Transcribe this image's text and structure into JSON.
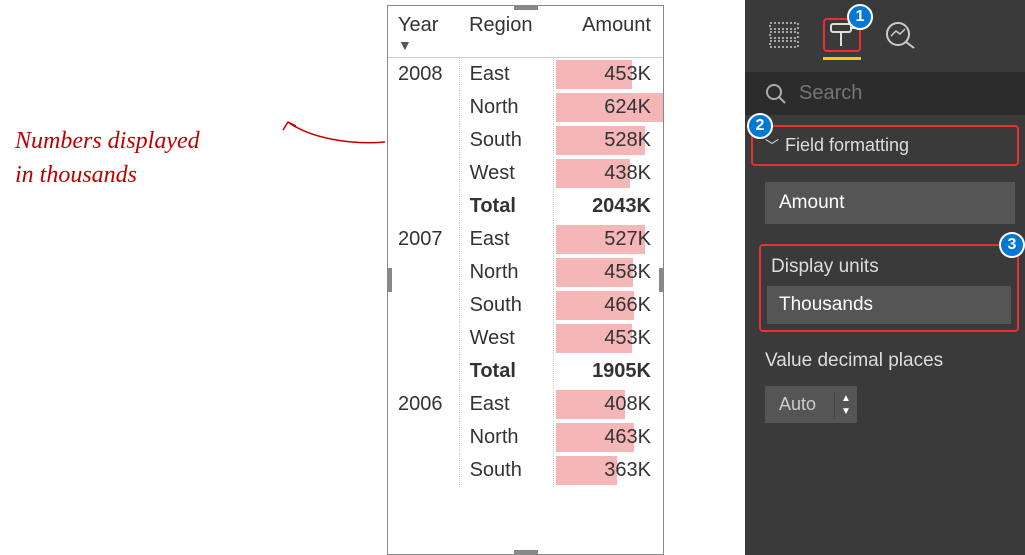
{
  "annotation": {
    "line1": "Numbers displayed",
    "line2": "in thousands"
  },
  "table": {
    "headers": {
      "year": "Year",
      "region": "Region",
      "amount": "Amount"
    },
    "rows": [
      {
        "year": "2008",
        "region": "East",
        "amount": "453K",
        "bar": 70
      },
      {
        "year": "",
        "region": "North",
        "amount": "624K",
        "bar": 98
      },
      {
        "year": "",
        "region": "South",
        "amount": "528K",
        "bar": 82
      },
      {
        "year": "",
        "region": "West",
        "amount": "438K",
        "bar": 68
      },
      {
        "year": "",
        "region": "Total",
        "amount": "2043K",
        "total": true
      },
      {
        "year": "2007",
        "region": "East",
        "amount": "527K",
        "bar": 82
      },
      {
        "year": "",
        "region": "North",
        "amount": "458K",
        "bar": 71
      },
      {
        "year": "",
        "region": "South",
        "amount": "466K",
        "bar": 72
      },
      {
        "year": "",
        "region": "West",
        "amount": "453K",
        "bar": 70
      },
      {
        "year": "",
        "region": "Total",
        "amount": "1905K",
        "total": true
      },
      {
        "year": "2006",
        "region": "East",
        "amount": "408K",
        "bar": 63
      },
      {
        "year": "",
        "region": "North",
        "amount": "463K",
        "bar": 72
      },
      {
        "year": "",
        "region": "South",
        "amount": "363K",
        "bar": 56
      }
    ]
  },
  "panel": {
    "search_placeholder": "Search",
    "section_label": "Field formatting",
    "field": "Amount",
    "display_units_label": "Display units",
    "display_units_value": "Thousands",
    "decimal_label": "Value decimal places",
    "decimal_value": "Auto"
  },
  "callouts": {
    "one": "1",
    "two": "2",
    "three": "3"
  }
}
